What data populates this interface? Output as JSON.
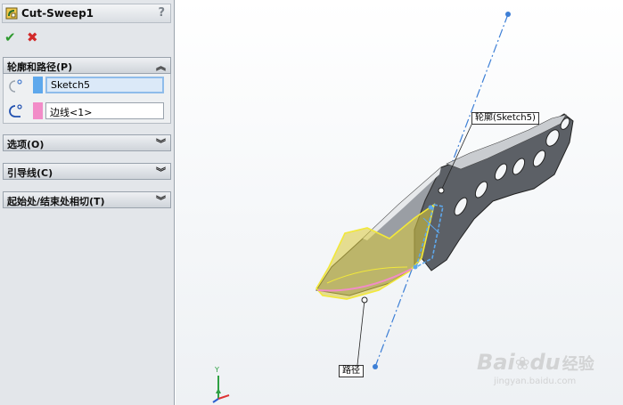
{
  "property_manager": {
    "title": "Cut-Sweep1",
    "help": "?",
    "ok_icon": "check-icon",
    "cancel_icon": "close-icon",
    "group_profile_path": {
      "label": "轮廓和路径(P)",
      "profile_value": "Sketch5",
      "path_value": "边线<1>",
      "profile_color": "#5ea8ec",
      "path_color": "#f28cc8"
    },
    "groups": [
      {
        "label": "选项(O)"
      },
      {
        "label": "引导线(C)"
      },
      {
        "label": "起始处/结束处相切(T)"
      }
    ]
  },
  "viewport": {
    "callout_profile": "轮廓(Sketch5)",
    "callout_path": "路径",
    "axis_y": "Y",
    "part_color": "#5c6066",
    "cut_color": "#e8e04a",
    "axis_line_color": "#3d7fd6"
  },
  "watermark": {
    "brand_a": "Bai",
    "brand_b": "du",
    "brand_c": "经验",
    "url": "jingyan.baidu.com"
  }
}
